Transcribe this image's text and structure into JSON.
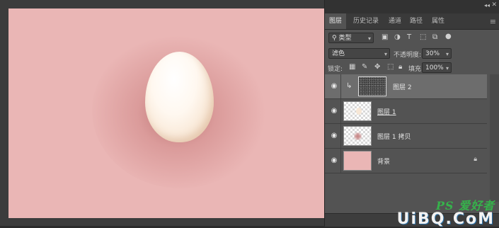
{
  "panel": {
    "tabs": [
      {
        "label": "图层",
        "active": true
      },
      {
        "label": "历史记录"
      },
      {
        "label": "通道"
      },
      {
        "label": "路径"
      },
      {
        "label": "属性"
      }
    ],
    "collapse": "◂◂",
    "close": "✕",
    "menu": "≡"
  },
  "filter": {
    "kind_value": "类型",
    "icons": [
      "image-filter-icon",
      "adjustment-filter-icon",
      "text-filter-icon",
      "shape-filter-icon",
      "smart-object-filter-icon",
      "filter-toggle-icon"
    ]
  },
  "blend": {
    "mode": "滤色",
    "opacity_label": "不透明度:",
    "opacity_value": "30%"
  },
  "lock": {
    "label": "锁定:",
    "fill_label": "填充:",
    "fill_value": "100%"
  },
  "layers": [
    {
      "name": "图层 2",
      "selected": true,
      "clipped": true,
      "thumb": "noise"
    },
    {
      "name": "图层 1",
      "selected": false,
      "thumb": "egg"
    },
    {
      "name": "图层 1 拷贝",
      "selected": false,
      "thumb": "shadow"
    },
    {
      "name": "背景",
      "selected": false,
      "thumb": "pink",
      "locked": true
    }
  ],
  "canvas": {
    "background": "#eab6b5",
    "egg": "#fbf2e8"
  },
  "watermark": {
    "top": "PS 爱好者",
    "bottom": "UiBQ.CoM"
  }
}
